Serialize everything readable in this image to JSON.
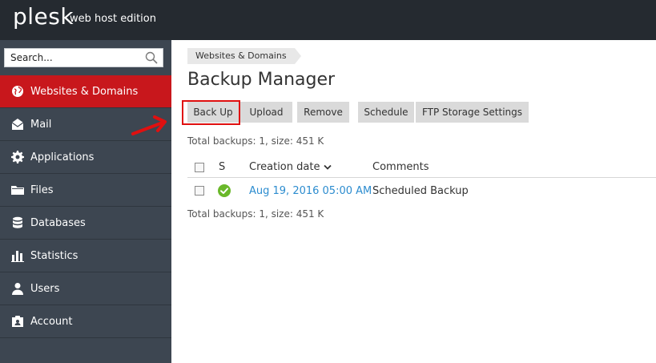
{
  "header": {
    "logo_text": "plesk",
    "edition": "web host edition"
  },
  "sidebar": {
    "search_placeholder": "Search...",
    "items": [
      {
        "label": "Websites & Domains",
        "icon": "globe-icon",
        "active": true
      },
      {
        "label": "Mail",
        "icon": "mail-icon"
      },
      {
        "label": "Applications",
        "icon": "gear-icon"
      },
      {
        "label": "Files",
        "icon": "folder-icon"
      },
      {
        "label": "Databases",
        "icon": "database-icon"
      },
      {
        "label": "Statistics",
        "icon": "bar-chart-icon"
      },
      {
        "label": "Users",
        "icon": "user-icon"
      },
      {
        "label": "Account",
        "icon": "account-icon"
      }
    ]
  },
  "main": {
    "breadcrumb": "Websites & Domains",
    "title": "Backup Manager",
    "toolbar": {
      "back_up": "Back Up",
      "upload": "Upload",
      "remove": "Remove",
      "schedule": "Schedule",
      "ftp_storage": "FTP Storage Settings"
    },
    "summary_top": "Total backups: 1, size: 451 K",
    "summary_bottom": "Total backups: 1, size: 451 K",
    "table": {
      "headers": {
        "status": "S",
        "creation_date": "Creation date",
        "comments": "Comments"
      },
      "rows": [
        {
          "status": "ok-icon",
          "creation_date": "Aug 19, 2016 05:00 AM",
          "comments": "Scheduled Backup"
        }
      ]
    }
  },
  "colors": {
    "topbar": "#252a30",
    "sidebar": "#3d4651",
    "active_nav": "#c8171c",
    "link": "#2c8ccf",
    "annotation": "#e01010",
    "status_ok": "#6ab82a"
  }
}
